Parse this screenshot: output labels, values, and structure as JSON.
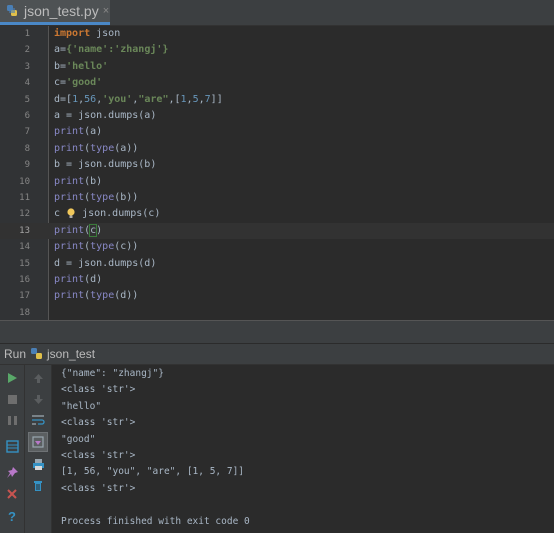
{
  "tab": {
    "label": "json_test.py",
    "close": "×"
  },
  "editor": {
    "lines": [
      {
        "n": "1",
        "parts": [
          [
            "kw",
            "import"
          ],
          [
            "p",
            " json"
          ]
        ]
      },
      {
        "n": "2",
        "parts": [
          [
            "p",
            "a"
          ],
          [
            "p",
            "="
          ],
          [
            "str",
            "{'name':'zhangj'}"
          ]
        ]
      },
      {
        "n": "3",
        "parts": [
          [
            "p",
            "b"
          ],
          [
            "p",
            "="
          ],
          [
            "str",
            "'hello'"
          ]
        ]
      },
      {
        "n": "4",
        "parts": [
          [
            "p",
            "c"
          ],
          [
            "p",
            "="
          ],
          [
            "str",
            "'good'"
          ]
        ]
      },
      {
        "n": "5",
        "parts": [
          [
            "p",
            "d"
          ],
          [
            "p",
            "=["
          ],
          [
            "num",
            "1"
          ],
          [
            "p",
            ","
          ],
          [
            "num",
            "56"
          ],
          [
            "p",
            ","
          ],
          [
            "str",
            "'you'"
          ],
          [
            "p",
            ","
          ],
          [
            "str",
            "\"are\""
          ],
          [
            "p",
            ",["
          ],
          [
            "num",
            "1"
          ],
          [
            "p",
            ","
          ],
          [
            "num",
            "5"
          ],
          [
            "p",
            ","
          ],
          [
            "num",
            "7"
          ],
          [
            "p",
            "]]"
          ]
        ]
      },
      {
        "n": "6",
        "parts": [
          [
            "p",
            "a = json.dumps(a)"
          ]
        ]
      },
      {
        "n": "7",
        "parts": [
          [
            "fn",
            "print"
          ],
          [
            "p",
            "(a)"
          ]
        ]
      },
      {
        "n": "8",
        "parts": [
          [
            "fn",
            "print"
          ],
          [
            "p",
            "("
          ],
          [
            "fn",
            "type"
          ],
          [
            "p",
            "(a))"
          ]
        ]
      },
      {
        "n": "9",
        "parts": [
          [
            "p",
            "b = json.dumps(b)"
          ]
        ]
      },
      {
        "n": "10",
        "parts": [
          [
            "fn",
            "print"
          ],
          [
            "p",
            "(b)"
          ]
        ]
      },
      {
        "n": "11",
        "parts": [
          [
            "fn",
            "print"
          ],
          [
            "p",
            "("
          ],
          [
            "fn",
            "type"
          ],
          [
            "p",
            "(b))"
          ]
        ]
      },
      {
        "n": "12",
        "parts": [
          [
            "p",
            "c "
          ],
          [
            "bulb",
            ""
          ],
          [
            "p",
            " json.dumps(c)"
          ]
        ]
      },
      {
        "n": "13",
        "parts": [
          [
            "fn",
            "print"
          ],
          [
            "p",
            "("
          ],
          [
            "box",
            "c"
          ],
          [
            "p",
            ")"
          ]
        ]
      },
      {
        "n": "14",
        "parts": [
          [
            "fn",
            "print"
          ],
          [
            "p",
            "("
          ],
          [
            "fn",
            "type"
          ],
          [
            "p",
            "(c))"
          ]
        ]
      },
      {
        "n": "15",
        "parts": [
          [
            "p",
            "d = json.dumps(d)"
          ]
        ]
      },
      {
        "n": "16",
        "parts": [
          [
            "fn",
            "print"
          ],
          [
            "p",
            "(d)"
          ]
        ]
      },
      {
        "n": "17",
        "parts": [
          [
            "fn",
            "print"
          ],
          [
            "p",
            "("
          ],
          [
            "fn",
            "type"
          ],
          [
            "p",
            "(d))"
          ]
        ]
      },
      {
        "n": "18",
        "parts": []
      }
    ],
    "current_line": "13"
  },
  "run": {
    "label": "Run",
    "config": "json_test"
  },
  "console": {
    "lines": [
      "{\"name\": \"zhangj\"}",
      "<class 'str'>",
      "\"hello\"",
      "<class 'str'>",
      "\"good\"",
      "<class 'str'>",
      "[1, 56, \"you\", \"are\", [1, 5, 7]]",
      "<class 'str'>",
      "",
      "Process finished with exit code 0"
    ]
  },
  "colors": {
    "run_green": "#59a869",
    "stop_gray": "#6e6e6e",
    "close_red": "#c75450",
    "help_blue": "#3592c4"
  },
  "icons": [
    "python-file-icon",
    "run-icon",
    "stop-icon",
    "pause-icon",
    "scroll-up-icon",
    "scroll-down-icon",
    "soft-wrap-icon",
    "scroll-to-end-icon",
    "print-icon",
    "clear-icon",
    "layout-icon",
    "pin-icon",
    "close-icon",
    "help-icon",
    "lightbulb-icon"
  ]
}
